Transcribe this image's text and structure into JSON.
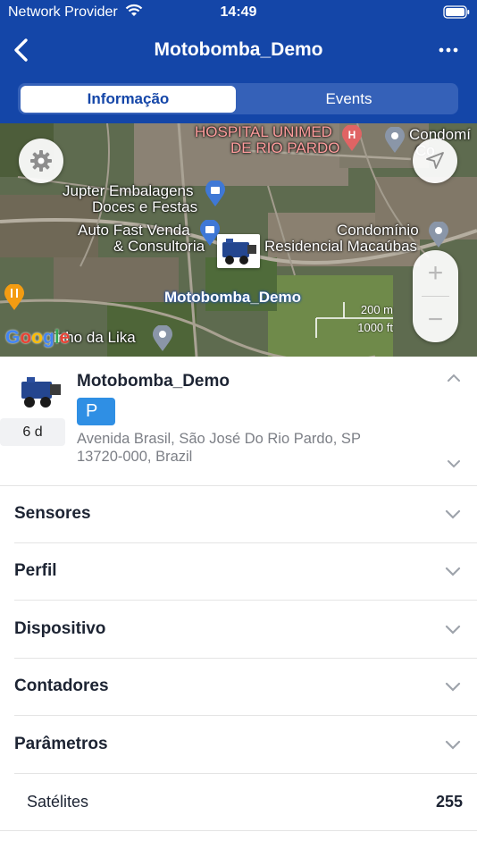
{
  "status": {
    "carrier": "Network Provider",
    "time": "14:49"
  },
  "nav": {
    "title": "Motobomba_Demo",
    "back_icon": "chevron-left-icon",
    "more_icon": "ellipsis-icon"
  },
  "tabs": [
    {
      "label": "Informação",
      "active": true
    },
    {
      "label": "Events",
      "active": false
    }
  ],
  "map": {
    "labels": {
      "hospital_line1": "HOSPITAL UNIMED",
      "hospital_line2": "DE RIO PARDO",
      "condo_top": "Condomí",
      "condo_top2": "Co",
      "jupter_line1": "Jupter Embalagens",
      "jupter_line2": "Doces e Festas",
      "autofast_line1": "Auto Fast Venda",
      "autofast_line2": "& Consultoria",
      "condo_mid": "Condomínio",
      "residencial": "Residencial Macaúbas",
      "lika": "inho da Lika"
    },
    "device_label": "Motobomba_Demo",
    "scale_metric": "200 m",
    "scale_imperial": "1000 ft",
    "google_logo": "Google",
    "zoom_in": "+",
    "zoom_out": "−"
  },
  "device": {
    "name": "Motobomba_Demo",
    "age": "6 d",
    "status_badge": "P",
    "address_line1": "Avenida Brasil, São José Do Rio Pardo, SP",
    "address_line2": "13720-000, Brazil",
    "badge_color": "#2f8fe4"
  },
  "sections": [
    {
      "label": "Sensores"
    },
    {
      "label": "Perfil"
    },
    {
      "label": "Dispositivo"
    },
    {
      "label": "Contadores"
    },
    {
      "label": "Parâmetros"
    }
  ],
  "detail_row": {
    "label": "Satélites",
    "value": "255"
  },
  "colors": {
    "header": "#1446a8",
    "accent": "#2f8fe4"
  }
}
